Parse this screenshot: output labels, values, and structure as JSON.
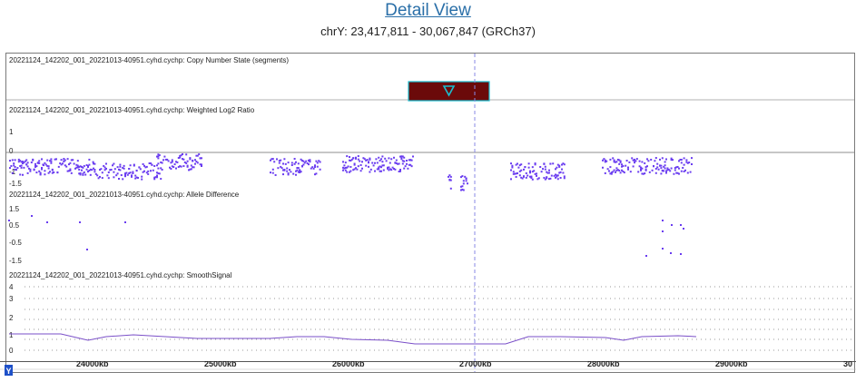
{
  "header": {
    "title": "Detail View",
    "subtitle": "chrY: 23,417,811 - 30,067,847 (GRCh37)"
  },
  "colors": {
    "data_points": "#6a3df0",
    "segment_fill": "#6b0a0a",
    "segment_border": "#1bbfd0",
    "cursor_line": "#8a8ae6",
    "smooth_line": "#7a4fc8"
  },
  "tracks": {
    "copy_number": {
      "label": "20221124_142202_001_20221013-40951.cyhd.cychp: Copy Number State (segments)",
      "segment_icon": "down-triangle-icon"
    },
    "log2": {
      "label": "20221124_142202_001_20221013-40951.cyhd.cychp: Weighted Log2 Ratio",
      "ticks": [
        "1",
        "0",
        "-1",
        "-1.5"
      ]
    },
    "allele": {
      "label": "20221124_142202_001_20221013-40951.cyhd.cychp: Allele Difference",
      "ticks": [
        "1.5",
        "0.5",
        "-0.5",
        "-1.5"
      ]
    },
    "smooth": {
      "label": "20221124_142202_001_20221013-40951.cyhd.cychp: SmoothSignal",
      "ticks": [
        "4",
        "3",
        "2",
        "1",
        "0"
      ]
    }
  },
  "xaxis": {
    "ticks": [
      "24000kb",
      "25000kb",
      "26000kb",
      "27000kb",
      "28000kb",
      "29000kb",
      "30"
    ],
    "marker_icon": "position-marker-icon",
    "marker_label": "Y"
  }
}
